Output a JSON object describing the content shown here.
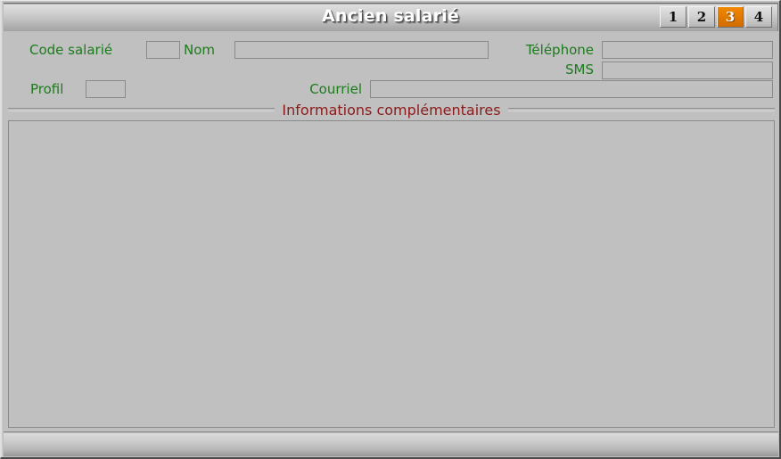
{
  "window": {
    "title": "Ancien salarié"
  },
  "tabs": [
    {
      "label": "1",
      "active": false
    },
    {
      "label": "2",
      "active": false
    },
    {
      "label": "3",
      "active": true
    },
    {
      "label": "4",
      "active": false
    }
  ],
  "form": {
    "code_salarie": {
      "label": "Code salarié",
      "value": "",
      "placeholder": ""
    },
    "nom": {
      "label": "Nom",
      "value": "",
      "placeholder": ""
    },
    "telephone": {
      "label": "Téléphone",
      "value": "",
      "placeholder": ""
    },
    "sms": {
      "label": "SMS",
      "value": "",
      "placeholder": ""
    },
    "profil": {
      "label": "Profil",
      "value": "",
      "placeholder": ""
    },
    "courriel": {
      "label": "Courriel",
      "value": "",
      "placeholder": ""
    }
  },
  "section": {
    "title": "Informations complémentaires",
    "body_text": ""
  },
  "colors": {
    "label_green": "#1d7a1d",
    "section_red": "#8b1a1a",
    "tab_active_orange": "#e07800",
    "window_face": "#c0c0c0"
  }
}
